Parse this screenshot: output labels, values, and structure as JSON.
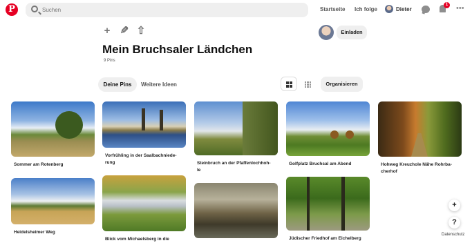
{
  "header": {
    "logo_letter": "P",
    "search_placeholder": "Suchen",
    "nav": [
      "Startseite",
      "Ich folge"
    ],
    "user_name": "Dieter",
    "notification_count": "1",
    "more": "•••"
  },
  "board": {
    "actions": [
      "+",
      "✎",
      "⇧"
    ],
    "invite_label": "Einladen",
    "title": "Mein Bruchsaler Ländchen",
    "pin_count": "9 Pins"
  },
  "tabs": [
    "Deine Pins",
    "Weitere Ideen"
  ],
  "organize_label": "Organisieren",
  "pins": [
    {
      "caption": "Sommer am Rotenberg"
    },
    {
      "caption": "Vorfrühling in der Saalbachniede-\nrung"
    },
    {
      "caption": "Steinbruch an der Pfaffenlochhoh-\nle"
    },
    {
      "caption": "Golfplatz Bruchsal am Abend"
    },
    {
      "caption": "Hohweg Kreuzhole Nähe Rohrba-\ncherhof"
    },
    {
      "caption": "Heidelsheimer Weg"
    },
    {
      "caption": "Blick vom Michaelsberg in die"
    },
    {
      "caption": ""
    },
    {
      "caption": "Jüdischer Friedhof am Eichelberg"
    }
  ],
  "fab": {
    "add": "+",
    "help": "?"
  },
  "footer": {
    "privacy": "Datenschutz"
  }
}
